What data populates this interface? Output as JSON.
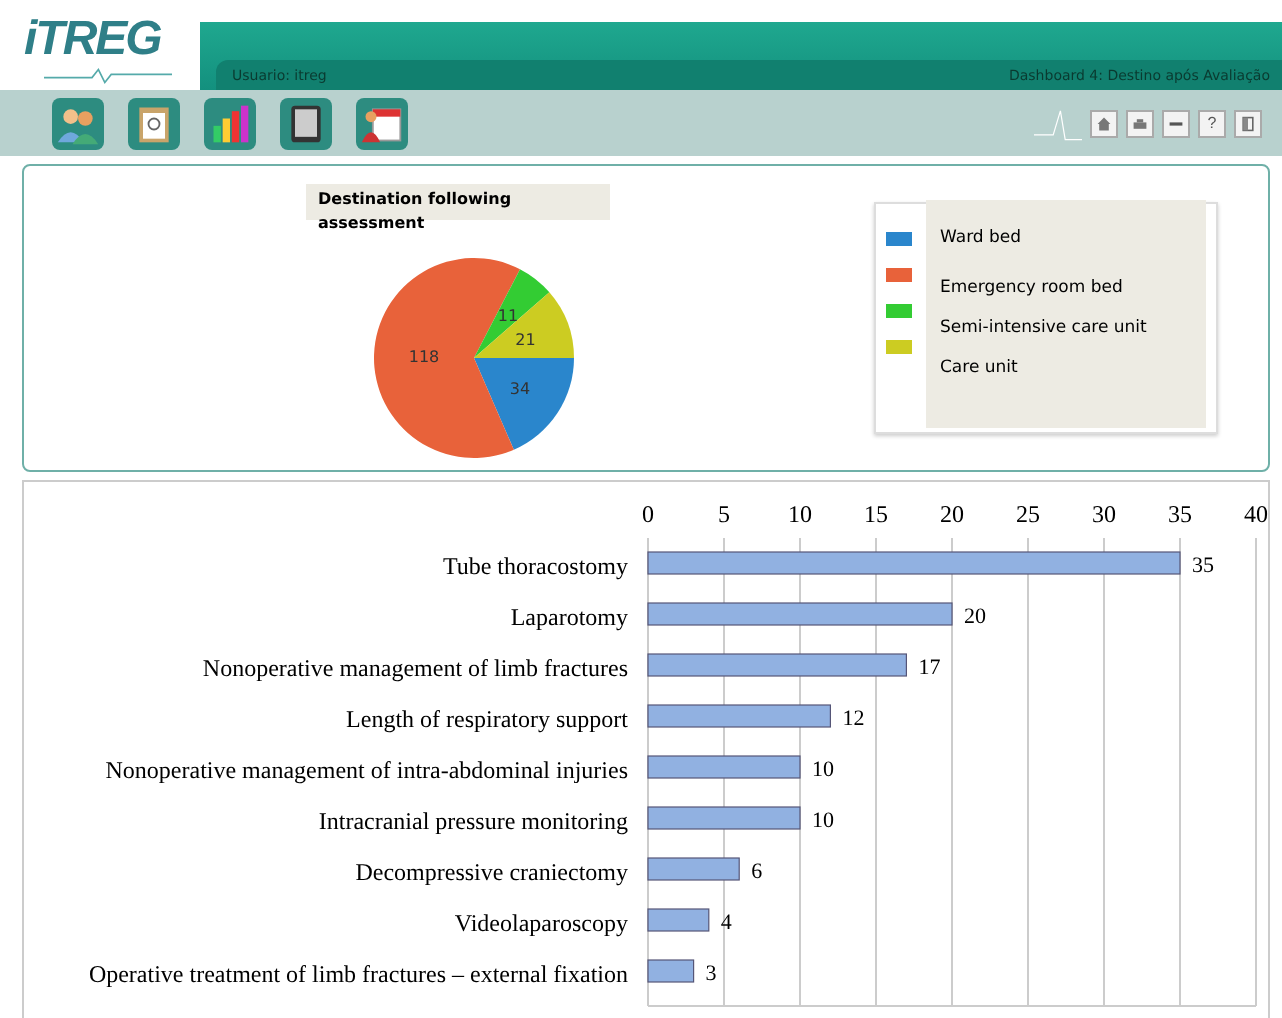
{
  "header": {
    "logo": "iTREG",
    "user": "Usuario: itreg",
    "dashboard": "Dashboard 4: Destino após Avaliação"
  },
  "toolbar": {
    "apps": [
      {
        "kind": "people"
      },
      {
        "kind": "clipboard"
      },
      {
        "kind": "chart"
      },
      {
        "kind": "tablet"
      },
      {
        "kind": "calendar"
      }
    ],
    "actions": [
      {
        "kind": "home"
      },
      {
        "kind": "print"
      },
      {
        "kind": "minimize"
      },
      {
        "label": "?",
        "kind": "help"
      },
      {
        "kind": "exit"
      }
    ]
  },
  "pie_panel": {
    "chart_data": {
      "type": "pie",
      "title": "Destination following assessment",
      "categories": [
        "Ward bed",
        "Emergency room bed",
        "Semi-intensive care unit",
        "Care unit"
      ],
      "values": [
        34,
        118,
        11,
        21
      ],
      "data_labels": true
    },
    "legend": [
      {
        "color": "#2a86cc"
      },
      {
        "color": "#e8623a"
      },
      {
        "color": "#33cc33"
      },
      {
        "color": "#cccc22"
      }
    ]
  },
  "bar_panel": {
    "chart_data": {
      "type": "bar",
      "orientation": "horizontal",
      "categories": [
        "Tube thoracostomy",
        "Laparotomy",
        "Nonoperative management of limb fractures",
        "Length of respiratory support",
        "Nonoperative management of intra-abdominal injuries",
        "Intracranial pressure monitoring",
        "Decompressive craniectomy",
        "Videolaparoscopy",
        "Operative treatment of limb fractures – external fixation"
      ],
      "series": [
        {
          "color": "#91b1e1",
          "values": [
            35,
            20,
            17,
            12,
            10,
            10,
            6,
            4,
            3
          ]
        }
      ],
      "xlim": [
        0,
        40
      ],
      "xticks": [
        0,
        5,
        10,
        15,
        20,
        25,
        30,
        35,
        40
      ],
      "grid": true,
      "data_labels": true
    }
  }
}
